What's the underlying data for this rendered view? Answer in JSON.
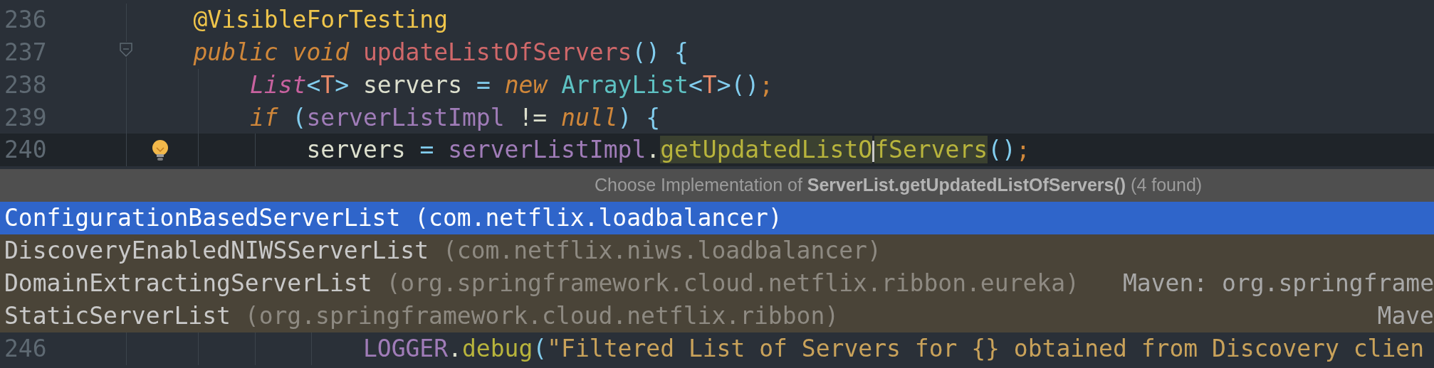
{
  "editor": {
    "lines": [
      {
        "number": "236",
        "current": false,
        "fold_marker": false,
        "intention_bulb": false,
        "tokens": [
          {
            "text": "    @VisibleForTesting",
            "kind": "annotation"
          }
        ]
      },
      {
        "number": "237",
        "current": false,
        "fold_marker": true,
        "intention_bulb": false,
        "tokens": [
          {
            "text": "    public void ",
            "kind": "keyword"
          },
          {
            "text": "updateListOfServers",
            "kind": "method"
          },
          {
            "text": "() {",
            "kind": "punct"
          }
        ]
      },
      {
        "number": "238",
        "current": false,
        "fold_marker": false,
        "intention_bulb": false,
        "tokens": [
          {
            "text": "        List",
            "kind": "type"
          },
          {
            "text": "<",
            "kind": "punct"
          },
          {
            "text": "T",
            "kind": "typeparam"
          },
          {
            "text": "> ",
            "kind": "punct"
          },
          {
            "text": "servers ",
            "kind": "plain"
          },
          {
            "text": "= ",
            "kind": "punct"
          },
          {
            "text": "new ",
            "kind": "keyword"
          },
          {
            "text": "ArrayList",
            "kind": "class"
          },
          {
            "text": "<",
            "kind": "punct"
          },
          {
            "text": "T",
            "kind": "typeparam"
          },
          {
            "text": ">()",
            "kind": "punct"
          },
          {
            "text": ";",
            "kind": "semi"
          }
        ]
      },
      {
        "number": "239",
        "current": false,
        "fold_marker": false,
        "intention_bulb": false,
        "tokens": [
          {
            "text": "        if ",
            "kind": "keyword"
          },
          {
            "text": "(",
            "kind": "punct"
          },
          {
            "text": "serverListImpl",
            "kind": "field"
          },
          {
            "text": " != ",
            "kind": "plain"
          },
          {
            "text": "null",
            "kind": "keyword"
          },
          {
            "text": ") {",
            "kind": "punct"
          }
        ]
      },
      {
        "number": "240",
        "current": true,
        "fold_marker": false,
        "intention_bulb": true,
        "tokens": [
          {
            "text": "            servers ",
            "kind": "plain"
          },
          {
            "text": "= ",
            "kind": "punct"
          },
          {
            "text": "serverListImpl",
            "kind": "field"
          },
          {
            "text": ".",
            "kind": "plain"
          },
          {
            "text": "getUpdatedListO",
            "kind": "call",
            "highlight": true,
            "caret": true
          },
          {
            "text": "fServers",
            "kind": "call",
            "highlight": true,
            "caret": false
          },
          {
            "text": "()",
            "kind": "punct"
          },
          {
            "text": ";",
            "kind": "semi"
          }
        ]
      }
    ]
  },
  "popup": {
    "title": "Choose Implementation of **ServerList.getUpdatedListOfServers()** (4 found)",
    "items": [
      {
        "name": "ConfigurationBasedServerList",
        "package": "(com.netflix.loadbalancer)",
        "selected": true
      },
      {
        "name": "DiscoveryEnabledNIWSServerList",
        "package": "(com.netflix.niws.loadbalancer)",
        "selected": false
      },
      {
        "name": "DomainExtractingServerList",
        "package": "(org.springframework.cloud.netflix.ribbon.eureka)",
        "location": "Maven: org.springframe",
        "selected": false
      },
      {
        "name": "StaticServerList",
        "package": "(org.springframework.cloud.netflix.ribbon)",
        "location": "Mave",
        "selected": false
      }
    ]
  },
  "editor_below": {
    "lines": [
      {
        "number": "246",
        "current": false,
        "fold_marker": false,
        "intention_bulb": false,
        "tokens": [
          {
            "text": "                LOGGER",
            "kind": "field"
          },
          {
            "text": ".",
            "kind": "plain"
          },
          {
            "text": "debug",
            "kind": "call"
          },
          {
            "text": "(",
            "kind": "punct"
          },
          {
            "text": "\"Filtered List of Servers for {} obtained from Discovery clien",
            "kind": "string"
          }
        ]
      }
    ]
  }
}
